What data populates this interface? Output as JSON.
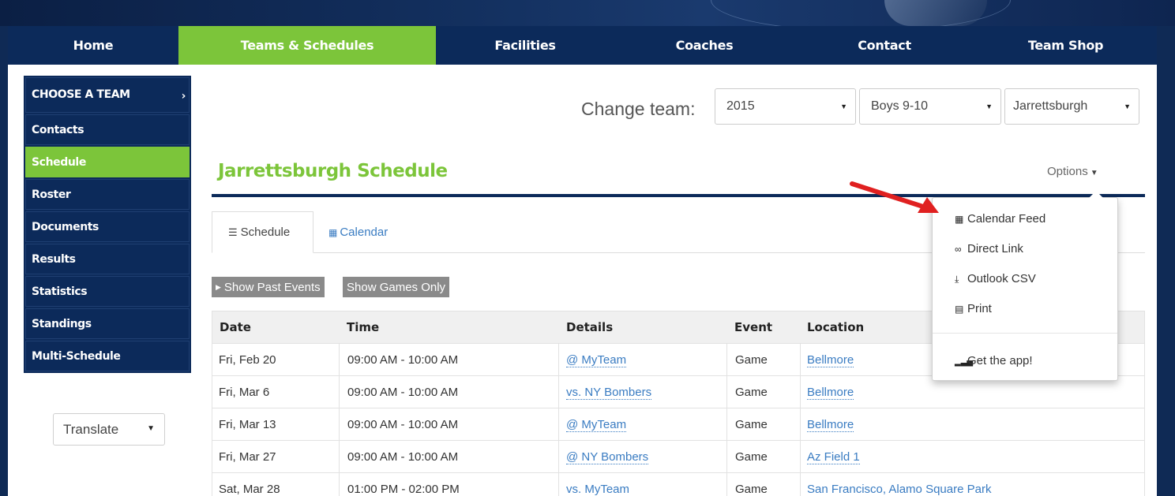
{
  "nav": {
    "items": [
      "Home",
      "Teams & Schedules",
      "Facilities",
      "Coaches",
      "Contact",
      "Team Shop"
    ],
    "active": "Teams & Schedules"
  },
  "sidebar": {
    "items": [
      "CHOOSE A TEAM",
      "Contacts",
      "Schedule",
      "Roster",
      "Documents",
      "Results",
      "Statistics",
      "Standings",
      "Multi-Schedule"
    ],
    "active": "Schedule"
  },
  "translate": {
    "label": "Translate"
  },
  "team_picker": {
    "label": "Change team:",
    "year": "2015",
    "division": "Boys 9-10",
    "team": "Jarrettsburgh"
  },
  "page_title": "Jarrettsburgh Schedule",
  "options_label": "Options",
  "tabs": [
    "Schedule",
    "Calendar"
  ],
  "buttons": {
    "past": "Show Past Events",
    "games": "Show Games Only"
  },
  "table": {
    "headers": [
      "Date",
      "Time",
      "Details",
      "Event",
      "Location"
    ],
    "rows": [
      [
        "Fri, Feb 20",
        "09:00 AM - 10:00 AM",
        "@ MyTeam",
        "Game",
        "Bellmore"
      ],
      [
        "Fri, Mar 6",
        "09:00 AM - 10:00 AM",
        "vs. NY Bombers",
        "Game",
        "Bellmore"
      ],
      [
        "Fri, Mar 13",
        "09:00 AM - 10:00 AM",
        "@ MyTeam",
        "Game",
        "Bellmore"
      ],
      [
        "Fri, Mar 27",
        "09:00 AM - 10:00 AM",
        "@ NY Bombers",
        "Game",
        "Az Field 1"
      ],
      [
        "Sat, Mar 28",
        "01:00 PM - 02:00 PM",
        "vs. MyTeam",
        "Game",
        "San Francisco, Alamo Square Park"
      ]
    ]
  },
  "options_menu": {
    "items": [
      "Calendar Feed",
      "Direct Link",
      "Outlook CSV",
      "Print"
    ],
    "app": "Get the app!"
  },
  "colors": {
    "navy": "#0c2a5a",
    "green": "#7cc53a",
    "link": "#3a7cc2",
    "arrow": "#e02020"
  },
  "icons": [
    "chevron-right-icon",
    "caret-down-icon",
    "list-icon",
    "calendar-icon",
    "link-icon",
    "download-icon",
    "print-icon",
    "signal-icon"
  ]
}
